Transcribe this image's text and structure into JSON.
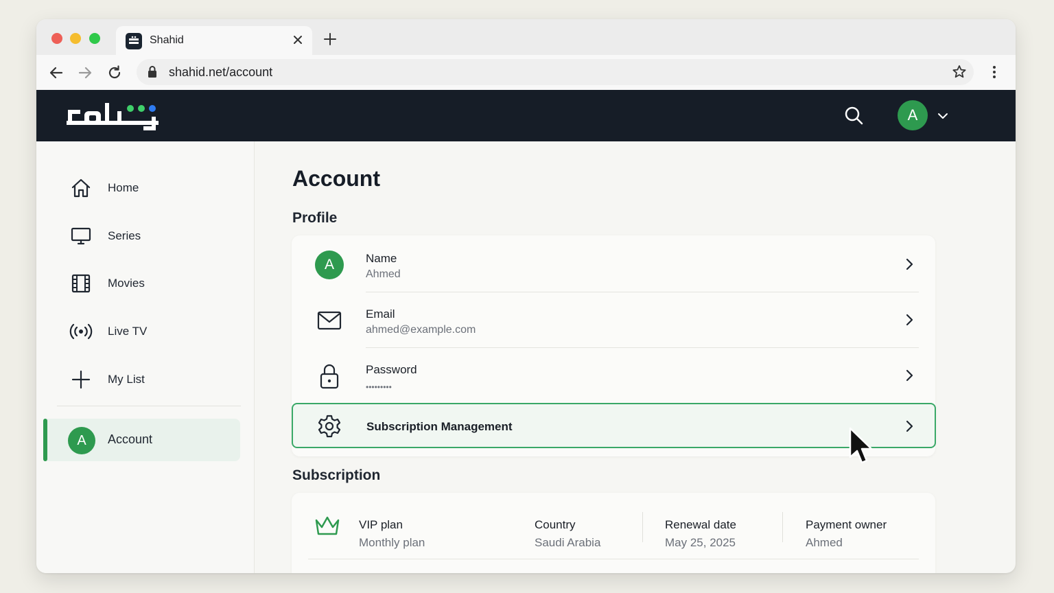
{
  "browser": {
    "tab_title": "Shahid",
    "url": "shahid.net/account"
  },
  "header": {
    "avatar_letter": "A"
  },
  "sidebar": {
    "items": [
      {
        "label": "Home",
        "icon": "home-icon"
      },
      {
        "label": "Series",
        "icon": "monitor-icon"
      },
      {
        "label": "Movies",
        "icon": "film-icon"
      },
      {
        "label": "Live TV",
        "icon": "broadcast-icon"
      },
      {
        "label": "My List",
        "icon": "plus-icon"
      }
    ],
    "active": {
      "label": "Account",
      "avatar_letter": "A"
    }
  },
  "main": {
    "title": "Account",
    "profile_heading": "Profile",
    "profile_rows": [
      {
        "label": "Name",
        "value": "Ahmed",
        "avatar_letter": "A"
      },
      {
        "label": "Email",
        "value": "ahmed@example.com"
      },
      {
        "label": "Password",
        "value": "•••••••••"
      }
    ],
    "subscription_management": "Subscription Management",
    "subscription_heading": "Subscription",
    "plan": {
      "name": "VIP plan",
      "billing": "Monthly plan",
      "country_label": "Country",
      "country": "Saudi Arabia",
      "renewal_label": "Renewal date",
      "renewal": "May 25, 2025",
      "owner_label": "Payment owner",
      "owner": "Ahmed"
    }
  },
  "colors": {
    "brand_green": "#2e9a4f",
    "header_dark": "#161d27",
    "accent_blue": "#2e7bf0"
  }
}
